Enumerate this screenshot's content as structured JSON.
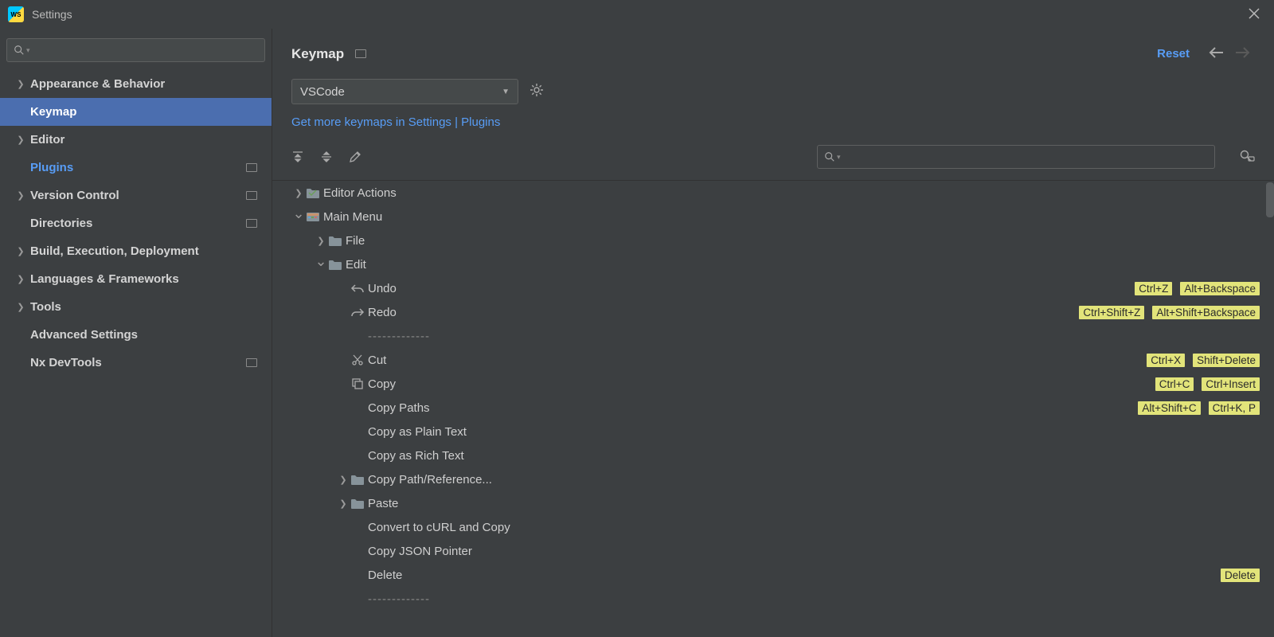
{
  "window": {
    "title": "Settings"
  },
  "sidebar": {
    "search_placeholder": "",
    "items": [
      {
        "label": "Appearance & Behavior",
        "expandable": true,
        "child": false
      },
      {
        "label": "Keymap",
        "expandable": false,
        "child": true,
        "selected": true
      },
      {
        "label": "Editor",
        "expandable": true,
        "child": false
      },
      {
        "label": "Plugins",
        "expandable": false,
        "child": true,
        "link": true,
        "badge": true
      },
      {
        "label": "Version Control",
        "expandable": true,
        "child": false,
        "badge": true
      },
      {
        "label": "Directories",
        "expandable": false,
        "child": true,
        "badge": true
      },
      {
        "label": "Build, Execution, Deployment",
        "expandable": true,
        "child": false
      },
      {
        "label": "Languages & Frameworks",
        "expandable": true,
        "child": false
      },
      {
        "label": "Tools",
        "expandable": true,
        "child": false
      },
      {
        "label": "Advanced Settings",
        "expandable": false,
        "child": true
      },
      {
        "label": "Nx DevTools",
        "expandable": false,
        "child": true,
        "badge": true
      }
    ]
  },
  "header": {
    "crumb": "Keymap",
    "reset": "Reset"
  },
  "keymap_dropdown": {
    "value": "VSCode"
  },
  "more_link": "Get more keymaps in Settings | Plugins",
  "actions_search_placeholder": "",
  "tree": [
    {
      "depth": 0,
      "arrow": "right",
      "icon": "editor",
      "label": "Editor Actions"
    },
    {
      "depth": 0,
      "arrow": "down",
      "icon": "menu",
      "label": "Main Menu"
    },
    {
      "depth": 1,
      "arrow": "right",
      "icon": "folder",
      "label": "File"
    },
    {
      "depth": 1,
      "arrow": "down",
      "icon": "folder",
      "label": "Edit"
    },
    {
      "depth": 2,
      "arrow": "",
      "icon": "undo",
      "label": "Undo",
      "shortcuts": [
        "Ctrl+Z",
        "Alt+Backspace"
      ]
    },
    {
      "depth": 2,
      "arrow": "",
      "icon": "redo",
      "label": "Redo",
      "shortcuts": [
        "Ctrl+Shift+Z",
        "Alt+Shift+Backspace"
      ]
    },
    {
      "depth": 2,
      "arrow": "",
      "icon": "",
      "label": "-------------",
      "sep": true
    },
    {
      "depth": 2,
      "arrow": "",
      "icon": "cut",
      "label": "Cut",
      "shortcuts": [
        "Ctrl+X",
        "Shift+Delete"
      ]
    },
    {
      "depth": 2,
      "arrow": "",
      "icon": "copy",
      "label": "Copy",
      "shortcuts": [
        "Ctrl+C",
        "Ctrl+Insert"
      ]
    },
    {
      "depth": 2,
      "arrow": "",
      "icon": "",
      "label": "Copy Paths",
      "shortcuts": [
        "Alt+Shift+C",
        "Ctrl+K, P"
      ]
    },
    {
      "depth": 2,
      "arrow": "",
      "icon": "",
      "label": "Copy as Plain Text"
    },
    {
      "depth": 2,
      "arrow": "",
      "icon": "",
      "label": "Copy as Rich Text"
    },
    {
      "depth": 2,
      "arrow": "right",
      "icon": "folder",
      "label": "Copy Path/Reference..."
    },
    {
      "depth": 2,
      "arrow": "right",
      "icon": "folder",
      "label": "Paste"
    },
    {
      "depth": 2,
      "arrow": "",
      "icon": "",
      "label": "Convert to cURL and Copy"
    },
    {
      "depth": 2,
      "arrow": "",
      "icon": "",
      "label": "Copy JSON Pointer"
    },
    {
      "depth": 2,
      "arrow": "",
      "icon": "",
      "label": "Delete",
      "shortcuts": [
        "Delete"
      ]
    },
    {
      "depth": 2,
      "arrow": "",
      "icon": "",
      "label": "-------------",
      "sep": true
    }
  ]
}
